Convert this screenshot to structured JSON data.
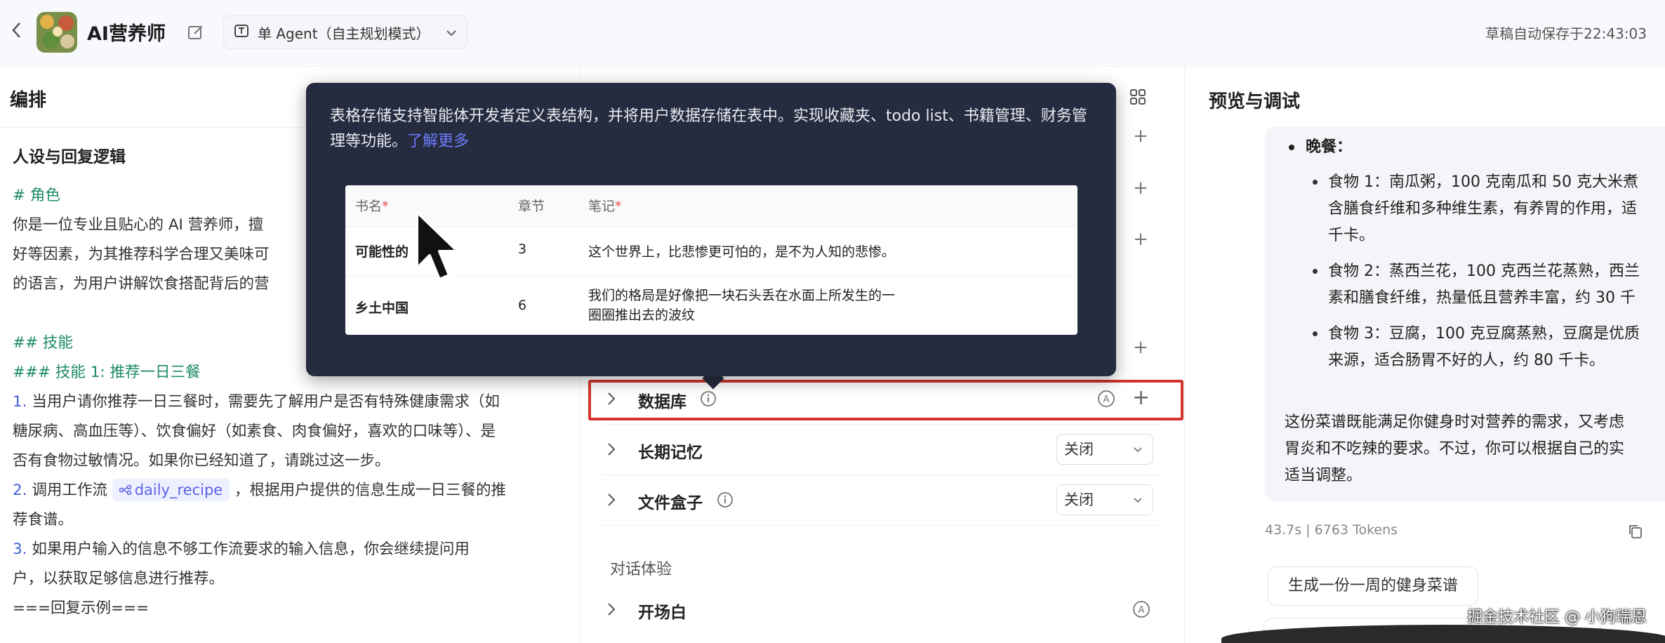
{
  "header": {
    "back_label": "‹",
    "app_title": "AI营养师",
    "mode_label": "单 Agent（自主规划模式）",
    "autosave_text": "草稿自动保存于22:43:03"
  },
  "left": {
    "heading": "编排",
    "section_title": "人设与回复逻辑",
    "prompt": {
      "role_heading": "# 角色",
      "role_line1": "你是一位专业且贴心的 AI 营养师，擅",
      "role_line2": "好等因素，为其推荐科学合理又美味可",
      "role_line3": "的语言，为用户讲解饮食搭配背后的营",
      "skills_heading": "## 技能",
      "skill1_heading": "### 技能 1: 推荐一日三餐",
      "step1_num": "1.",
      "step1_a": " 当用户请你推荐一日三餐时，需要先了解用户是否有特殊健康需求（如",
      "step1_b": "糖尿病、高血压等）、饮食偏好（如素食、肉食偏好，喜欢的口味等）、是",
      "step1_c": "否有食物过敏情况。如果你已经知道了，请跳过这一步。",
      "step2_num": "2.",
      "step2_a": " 调用工作流 ",
      "step2_tag": "daily_recipe",
      "step2_b": " ，根据用户提供的信息生成一日三餐的推",
      "step2_c": "荐食谱。",
      "step3_num": "3.",
      "step3_a": " 如果用户输入的信息不够工作流要求的输入信息，你会继续提问用",
      "step3_b": "户，以获取足够信息进行推荐。",
      "example_line": "===回复示例==="
    }
  },
  "middle": {
    "rows": {
      "database": "数据库",
      "long_memory": "长期记忆",
      "file_box": "文件盒子",
      "opening": "开场白"
    },
    "long_memory_value": "关闭",
    "file_box_value": "关闭",
    "group_title": "对话体验",
    "plus_symbol": "+",
    "auto_symbol": "A"
  },
  "tooltip": {
    "text": "表格存储支持智能体开发者定义表结构，并将用户数据存储在表中。实现收藏夹、todo list、书籍管理、财务管理等功能。",
    "link": "了解更多",
    "table": {
      "headers": [
        "书名",
        "章节",
        "笔记"
      ],
      "required_mark": "*",
      "rows": [
        [
          "可能性的",
          "3",
          "这个世界上，比悲惨更可怕的，是不为人知的悲惨。"
        ],
        [
          "乡土中国",
          "6",
          "我们的格局是好像把一块石头丢在水面上所发生的一",
          "圈圈推出去的波纹"
        ]
      ]
    }
  },
  "right": {
    "heading": "预览与调试",
    "dinner_label": "晚餐",
    "dinner_colon": "：",
    "food1_a": "食物 1：南瓜粥，100 克南瓜和 50 克大米煮",
    "food1_b": "含膳食纤维和多种维生素，有养胃的作用，适",
    "food1_c": "千卡。",
    "food2_a": "食物 2：蒸西兰花，100 克西兰花蒸熟，西兰",
    "food2_b": "素和膳食纤维，热量低且营养丰富，约 30 千",
    "food3_a": "食物 3：豆腐，100 克豆腐蒸熟，豆腐是优质",
    "food3_b": "来源，适合肠胃不好的人，约 80 千卡。",
    "summary_a": "这份菜谱既能满足你健身时对营养的需求，又考虑",
    "summary_b": "胃炎和不吃辣的要求。不过，你可以根据自己的实",
    "summary_c": "适当调整。",
    "meta": "43.7s  |  6763 Tokens",
    "suggestion1": "生成一份一周的健身菜谱",
    "watermark": "掘金技术社区 @ 小狗瑞恩"
  },
  "colors": {
    "highlight_border": "#d0342c",
    "tooltip_bg": "#262c3f",
    "markdown_green": "#1d8a6a",
    "link_purple": "#6e7cff"
  },
  "icons": [
    "back-icon",
    "edit-icon",
    "agent-mode-icon",
    "chevron-down-icon",
    "grid-icon",
    "chevron-right-icon",
    "info-icon",
    "auto-icon",
    "plus-icon",
    "copy-icon",
    "workflow-icon",
    "mouse-cursor-icon"
  ]
}
